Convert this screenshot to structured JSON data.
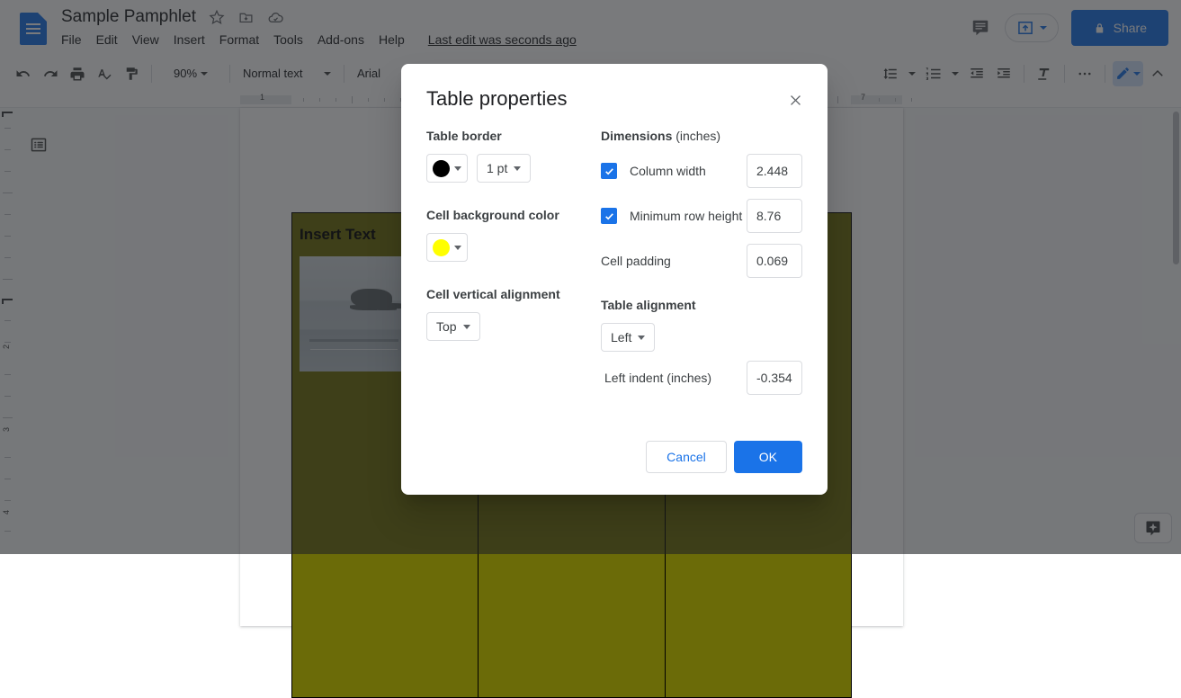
{
  "app": {
    "doc_title": "Sample Pamphlet",
    "last_edit": "Last edit was seconds ago",
    "menus": [
      "File",
      "Edit",
      "View",
      "Insert",
      "Format",
      "Tools",
      "Add-ons",
      "Help"
    ],
    "icons": {
      "logo": "docs-logo-icon",
      "star": "star-icon",
      "move": "move-to-folder-icon",
      "cloud": "cloud-saved-icon",
      "comment": "comment-icon",
      "present": "present-icon",
      "share_lock": "lock-icon"
    },
    "share_label": "Share"
  },
  "toolbar": {
    "zoom": "90%",
    "style": "Normal text",
    "font": "Arial",
    "icons": [
      "undo-icon",
      "redo-icon",
      "print-icon",
      "spellcheck-icon",
      "paint-format-icon",
      "line-spacing-icon",
      "bulleted-list-icon",
      "numbered-list-icon",
      "decrease-indent-icon",
      "increase-indent-icon",
      "clear-formatting-icon",
      "more-options-icon",
      "editing-mode-pencil-icon",
      "collapse-toolbar-icon"
    ]
  },
  "ruler": {
    "h_labels": [
      "1",
      "1",
      "7"
    ],
    "v_labels": [
      "2",
      "3",
      "4"
    ]
  },
  "document": {
    "cell_heading": "Insert Text",
    "cell_bg_color": "#6b6b08",
    "outline_icon": "document-outline-icon",
    "explore_icon": "explore-icon"
  },
  "dialog": {
    "title": "Table properties",
    "close_icon": "close-icon",
    "table_border": {
      "label": "Table border",
      "color": "#000000",
      "color_name": "black-swatch",
      "width": "1 pt"
    },
    "cell_background": {
      "label": "Cell background color",
      "color": "#ffff00",
      "color_name": "yellow-swatch"
    },
    "cell_vertical_alignment": {
      "label": "Cell vertical alignment",
      "value": "Top"
    },
    "dimensions": {
      "label": "Dimensions",
      "unit": "(inches)",
      "column_width": {
        "label": "Column width",
        "checked": true,
        "value": "2.448"
      },
      "minimum_row_height": {
        "label": "Minimum row height",
        "checked": true,
        "value": "8.76"
      },
      "cell_padding": {
        "label": "Cell padding",
        "value": "0.069"
      }
    },
    "table_alignment": {
      "label": "Table alignment",
      "value": "Left",
      "left_indent_label": "Left indent",
      "left_indent_unit": "(inches)",
      "left_indent_value": "-0.354"
    },
    "cancel_label": "Cancel",
    "ok_label": "OK",
    "accent_color": "#1a73e8"
  }
}
